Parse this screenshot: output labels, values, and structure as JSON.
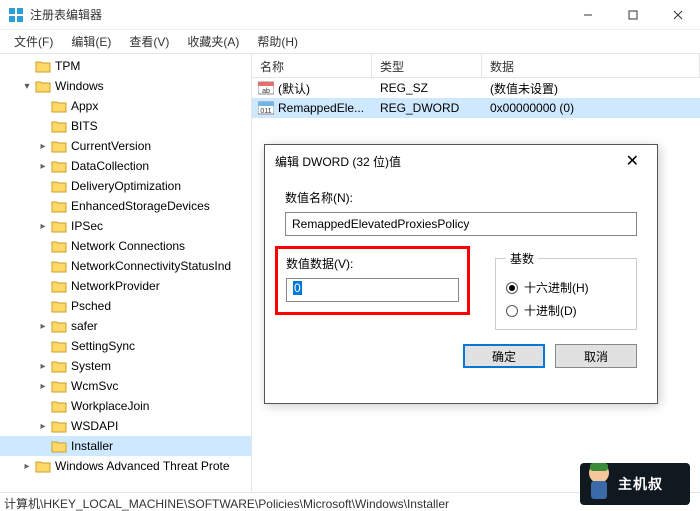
{
  "window": {
    "title": "注册表编辑器"
  },
  "menu": {
    "file": "文件(F)",
    "edit": "编辑(E)",
    "view": "查看(V)",
    "fav": "收藏夹(A)",
    "help": "帮助(H)"
  },
  "tree": {
    "tpm": "TPM",
    "windows": "Windows",
    "items": [
      {
        "n": "Appx",
        "c": 0
      },
      {
        "n": "BITS",
        "c": 0
      },
      {
        "n": "CurrentVersion",
        "c": 1
      },
      {
        "n": "DataCollection",
        "c": 1
      },
      {
        "n": "DeliveryOptimization",
        "c": 0
      },
      {
        "n": "EnhancedStorageDevices",
        "c": 0
      },
      {
        "n": "IPSec",
        "c": 1
      },
      {
        "n": "Network Connections",
        "c": 0
      },
      {
        "n": "NetworkConnectivityStatusInd",
        "c": 0
      },
      {
        "n": "NetworkProvider",
        "c": 0
      },
      {
        "n": "Psched",
        "c": 0
      },
      {
        "n": "safer",
        "c": 1
      },
      {
        "n": "SettingSync",
        "c": 0
      },
      {
        "n": "System",
        "c": 1
      },
      {
        "n": "WcmSvc",
        "c": 1
      },
      {
        "n": "WorkplaceJoin",
        "c": 0
      },
      {
        "n": "WSDAPI",
        "c": 1
      },
      {
        "n": "Installer",
        "c": 0,
        "sel": true
      }
    ],
    "adv": "Windows Advanced Threat Prote"
  },
  "columns": {
    "name": "名称",
    "type": "类型",
    "data": "数据"
  },
  "values": [
    {
      "icon": "sz",
      "name": "(默认)",
      "type": "REG_SZ",
      "data": "(数值未设置)"
    },
    {
      "icon": "dw",
      "name": "RemappedEle...",
      "type": "REG_DWORD",
      "data": "0x00000000 (0)",
      "sel": true
    }
  ],
  "dialog": {
    "title": "编辑 DWORD (32 位)值",
    "name_label": "数值名称(N):",
    "name_value": "RemappedElevatedProxiesPolicy",
    "data_label": "数值数据(V):",
    "data_value": "0",
    "base_label": "基数",
    "hex": "十六进制(H)",
    "dec": "十进制(D)",
    "ok": "确定",
    "cancel": "取消"
  },
  "statusbar": "计算机\\HKEY_LOCAL_MACHINE\\SOFTWARE\\Policies\\Microsoft\\Windows\\Installer",
  "mascot": "主机叔"
}
